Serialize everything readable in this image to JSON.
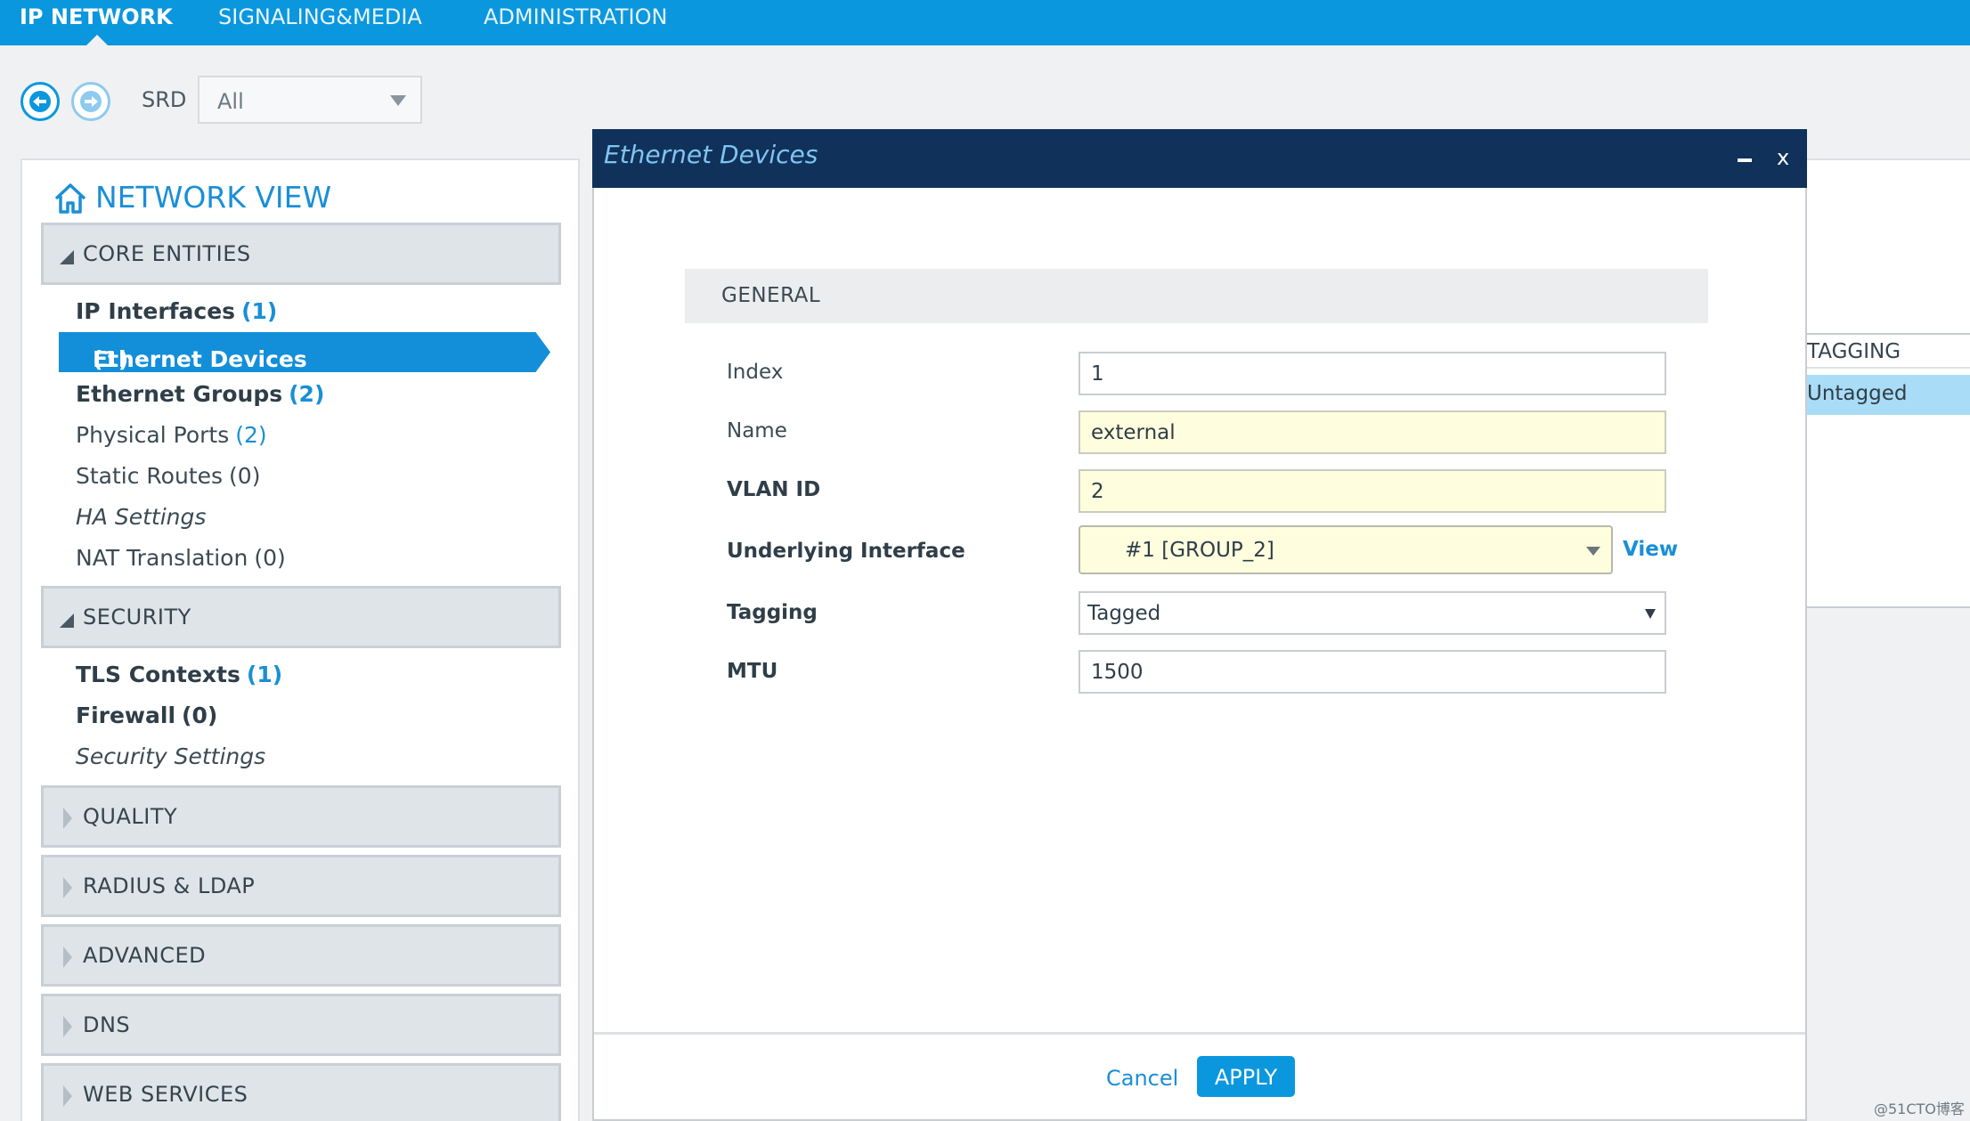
{
  "topnav": {
    "tabs": [
      {
        "label": "IP NETWORK",
        "active": true
      },
      {
        "label": "SIGNALING&MEDIA",
        "active": false
      },
      {
        "label": "ADMINISTRATION",
        "active": false
      }
    ]
  },
  "toolbar": {
    "back_icon": "arrow-left-circle-icon",
    "forward_icon": "arrow-right-circle-icon",
    "srd_label": "SRD",
    "srd_value": "All"
  },
  "network_view": {
    "title": "NETWORK VIEW",
    "icon": "home-icon",
    "sections": [
      {
        "label": "CORE ENTITIES",
        "expanded": true,
        "items": [
          {
            "label": "IP Interfaces",
            "count": "(1)"
          },
          {
            "label": "Ethernet Devices",
            "count": "(1)",
            "selected": true
          },
          {
            "label": "Ethernet Groups",
            "count": "(2)"
          },
          {
            "label": "Physical Ports",
            "count": "(2)"
          },
          {
            "label": "Static Routes",
            "count": "(0)"
          },
          {
            "label": "HA Settings",
            "count": ""
          },
          {
            "label": "NAT Translation",
            "count": "(0)"
          }
        ]
      },
      {
        "label": "SECURITY",
        "expanded": true,
        "items": [
          {
            "label": "TLS Contexts",
            "count": "(1)"
          },
          {
            "label": "Firewall",
            "count": "(0)"
          },
          {
            "label": "Security Settings",
            "count": ""
          }
        ]
      },
      {
        "label": "QUALITY",
        "expanded": false
      },
      {
        "label": "RADIUS & LDAP",
        "expanded": false
      },
      {
        "label": "ADVANCED",
        "expanded": false
      },
      {
        "label": "DNS",
        "expanded": false
      },
      {
        "label": "WEB SERVICES",
        "expanded": false
      }
    ]
  },
  "background_table": {
    "column_header": "TAGGING",
    "row_value": "Untagged"
  },
  "dialog": {
    "title": "Ethernet Devices",
    "minimize_icon": "minimize-icon",
    "close_label": "x",
    "section_label": "GENERAL",
    "fields": {
      "index": {
        "label": "Index",
        "value": "1"
      },
      "name": {
        "label": "Name",
        "value": "external"
      },
      "vlan_id": {
        "label": "VLAN ID",
        "value": "2"
      },
      "underlying_interface": {
        "label": "Underlying Interface",
        "value": "#1 [GROUP_2]",
        "link": "View"
      },
      "tagging": {
        "label": "Tagging",
        "value": "Tagged"
      },
      "mtu": {
        "label": "MTU",
        "value": "1500"
      }
    },
    "cancel_label": "Cancel",
    "apply_label": "APPLY"
  },
  "watermark": "@51CTO博客",
  "colors": {
    "brand_blue": "#0b97de",
    "dialog_header": "#10325a",
    "modified_field": "#fefdde",
    "selected_row": "#a9dcf6"
  }
}
